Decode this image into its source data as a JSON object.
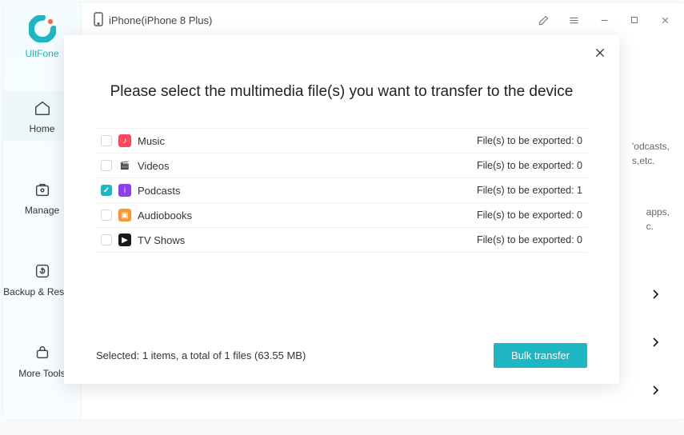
{
  "brand": "UltFone",
  "header": {
    "device_label": "iPhone(iPhone 8 Plus)"
  },
  "sidebar": {
    "items": [
      {
        "label": "Home"
      },
      {
        "label": "Manage"
      },
      {
        "label": "Backup & Restore"
      },
      {
        "label": "More Tools"
      }
    ]
  },
  "background_hints": {
    "line1a": "'odcasts,",
    "line1b": "s,etc.",
    "line2a": "apps,",
    "line2b": "c."
  },
  "modal": {
    "title": "Please select the multimedia file(s) you want to transfer to the device",
    "export_prefix": "File(s) to be exported: ",
    "items": [
      {
        "label": "Music",
        "checked": false,
        "count": "0",
        "icon_bg": "#ff4760",
        "glyph": "♪"
      },
      {
        "label": "Videos",
        "checked": false,
        "count": "0",
        "icon_bg": "#ffffff",
        "glyph": "🎬"
      },
      {
        "label": "Podcasts",
        "checked": true,
        "count": "1",
        "icon_bg": "#8a3ff0",
        "glyph": "i"
      },
      {
        "label": "Audiobooks",
        "checked": false,
        "count": "0",
        "icon_bg": "#ff9530",
        "glyph": "▣"
      },
      {
        "label": "TV Shows",
        "checked": false,
        "count": "0",
        "icon_bg": "#1a1a1a",
        "glyph": "▶"
      }
    ],
    "selected_summary": "Selected: 1 items, a total of 1 files (63.55 MB)",
    "bulk_button": "Bulk transfer"
  }
}
